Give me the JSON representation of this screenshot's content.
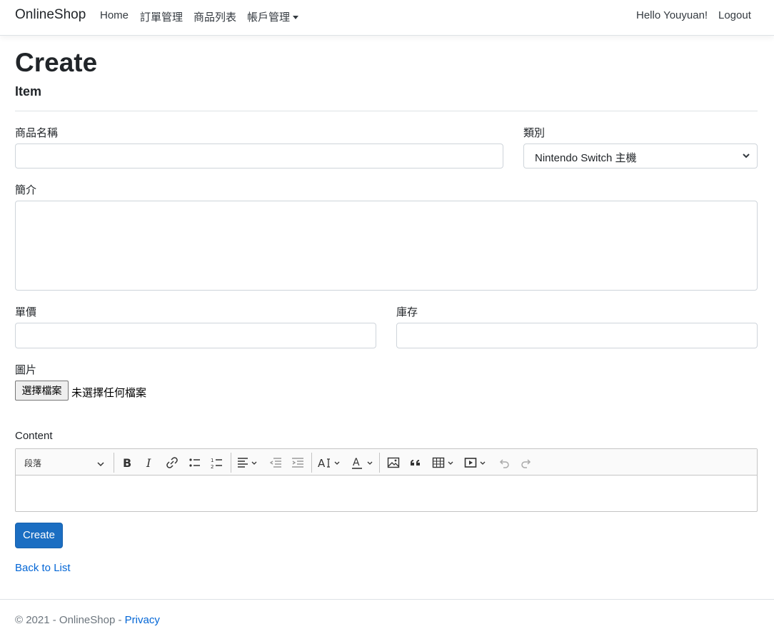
{
  "nav": {
    "brand": "OnlineShop",
    "links": [
      "Home",
      "訂單管理",
      "商品列表",
      "帳戶管理"
    ],
    "greeting": "Hello Youyuan!",
    "logout": "Logout"
  },
  "page": {
    "title": "Create",
    "subtitle": "Item"
  },
  "form": {
    "name_label": "商品名稱",
    "name_value": "",
    "category_label": "類別",
    "category_selected": "Nintendo Switch 主機",
    "intro_label": "簡介",
    "intro_value": "",
    "price_label": "單價",
    "price_value": "",
    "stock_label": "庫存",
    "stock_value": "",
    "image_label": "圖片",
    "file_button": "選擇檔案",
    "file_status": "未選擇任何檔案",
    "content_label": "Content",
    "editor": {
      "heading_select": "段落",
      "icons": [
        "bold-icon",
        "italic-icon",
        "link-icon",
        "bulleted-list-icon",
        "numbered-list-icon",
        "align-icon",
        "outdent-icon",
        "indent-icon",
        "font-size-icon",
        "font-color-icon",
        "image-icon",
        "blockquote-icon",
        "table-icon",
        "media-icon",
        "undo-icon",
        "redo-icon"
      ]
    },
    "submit": "Create"
  },
  "back_link": "Back to List",
  "footer": {
    "copyright": "© 2021 - OnlineShop - ",
    "privacy": "Privacy"
  },
  "colors": {
    "primary": "#1b6ec2",
    "link": "#0366d6",
    "border": "#ced4da"
  }
}
